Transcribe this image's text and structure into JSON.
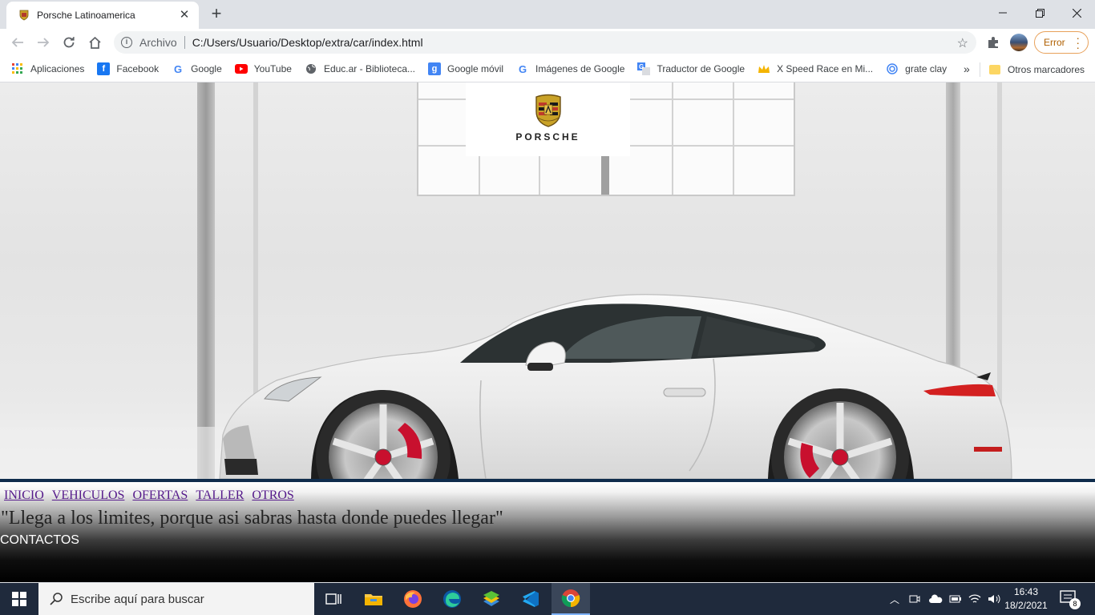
{
  "browser": {
    "tab_title": "Porsche Latinoamerica",
    "tab_close": "✕",
    "new_tab": "+",
    "address": {
      "scheme_label": "Archivo",
      "url": "C:/Users/Usuario/Desktop/extra/car/index.html"
    },
    "profile_error_label": "Error",
    "bookmarks": [
      {
        "label": "Aplicaciones",
        "icon": "apps-grid-icon"
      },
      {
        "label": "Facebook",
        "icon": "facebook-icon"
      },
      {
        "label": "Google",
        "icon": "google-icon"
      },
      {
        "label": "YouTube",
        "icon": "youtube-icon"
      },
      {
        "label": "Educ.ar - Biblioteca...",
        "icon": "globe-icon"
      },
      {
        "label": "Google móvil",
        "icon": "google-mobile-icon"
      },
      {
        "label": "Imágenes de Google",
        "icon": "google-icon"
      },
      {
        "label": "Traductor de Google",
        "icon": "translate-icon"
      },
      {
        "label": "X Speed Race en Mi...",
        "icon": "crown-icon"
      },
      {
        "label": "grate clay",
        "icon": "circle-icon"
      }
    ],
    "bookmarks_more": "»",
    "other_bookmarks": "Otros marcadores"
  },
  "page": {
    "logo_text": "PORSCHE",
    "nav": [
      "INICIO",
      "VEHICULOS",
      "OFERTAS",
      "TALLER",
      "OTROS"
    ],
    "quote": "\"Llega a los limites, porque asi sabras hasta donde puedes llegar\"",
    "contact": "CONTACTOS"
  },
  "taskbar": {
    "search_placeholder": "Escribe aquí para buscar",
    "time": "16:43",
    "date": "18/2/2021",
    "notifications_count": "8"
  },
  "colors": {
    "hero_border": "#0f2c4c",
    "visited_link": "#551a8b",
    "error_pill": "#b06000"
  }
}
